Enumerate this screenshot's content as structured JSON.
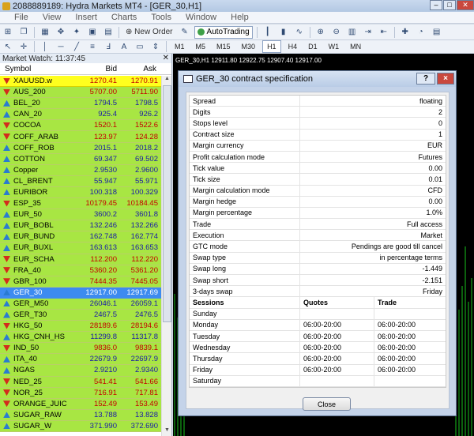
{
  "window": {
    "title": "2088889189: Hydra Markets MT4 - [GER_30,H1]"
  },
  "menu": [
    "File",
    "View",
    "Insert",
    "Charts",
    "Tools",
    "Window",
    "Help"
  ],
  "toolbar": {
    "new_order_label": "New Order",
    "autotrading_label": "AutoTrading"
  },
  "timeframes": [
    "M1",
    "M5",
    "M15",
    "M30",
    "H1",
    "H4",
    "D1",
    "W1",
    "MN"
  ],
  "active_timeframe": "H1",
  "market_watch": {
    "title": "Market Watch: 11:37:45",
    "columns": {
      "symbol": "Symbol",
      "bid": "Bid",
      "ask": "Ask"
    },
    "rows": [
      {
        "symbol": "XAUUSD.w",
        "bid": "1270.41",
        "ask": "1270.91",
        "dir": "down",
        "state": "highlight"
      },
      {
        "symbol": "AUS_200",
        "bid": "5707.00",
        "ask": "5711.90",
        "dir": "down"
      },
      {
        "symbol": "BEL_20",
        "bid": "1794.5",
        "ask": "1798.5",
        "dir": "up"
      },
      {
        "symbol": "CAN_20",
        "bid": "925.4",
        "ask": "926.2",
        "dir": "up"
      },
      {
        "symbol": "COCOA",
        "bid": "1520.1",
        "ask": "1522.6",
        "dir": "down"
      },
      {
        "symbol": "COFF_ARAB",
        "bid": "123.97",
        "ask": "124.28",
        "dir": "down"
      },
      {
        "symbol": "COFF_ROB",
        "bid": "2015.1",
        "ask": "2018.2",
        "dir": "up"
      },
      {
        "symbol": "COTTON",
        "bid": "69.347",
        "ask": "69.502",
        "dir": "up"
      },
      {
        "symbol": "Copper",
        "bid": "2.9530",
        "ask": "2.9600",
        "dir": "up"
      },
      {
        "symbol": "CL_BRENT",
        "bid": "55.947",
        "ask": "55.971",
        "dir": "up"
      },
      {
        "symbol": "EURIBOR",
        "bid": "100.318",
        "ask": "100.329",
        "dir": "up"
      },
      {
        "symbol": "ESP_35",
        "bid": "10179.45",
        "ask": "10184.45",
        "dir": "down"
      },
      {
        "symbol": "EUR_50",
        "bid": "3600.2",
        "ask": "3601.8",
        "dir": "up"
      },
      {
        "symbol": "EUR_BOBL",
        "bid": "132.246",
        "ask": "132.266",
        "dir": "up"
      },
      {
        "symbol": "EUR_BUND",
        "bid": "162.748",
        "ask": "162.774",
        "dir": "up"
      },
      {
        "symbol": "EUR_BUXL",
        "bid": "163.613",
        "ask": "163.653",
        "dir": "up"
      },
      {
        "symbol": "EUR_SCHA",
        "bid": "112.200",
        "ask": "112.220",
        "dir": "down"
      },
      {
        "symbol": "FRA_40",
        "bid": "5360.20",
        "ask": "5361.20",
        "dir": "down"
      },
      {
        "symbol": "GBR_100",
        "bid": "7444.35",
        "ask": "7445.05",
        "dir": "down"
      },
      {
        "symbol": "GER_30",
        "bid": "12917.00",
        "ask": "12917.69",
        "dir": "up",
        "state": "selected"
      },
      {
        "symbol": "GER_M50",
        "bid": "26046.1",
        "ask": "26059.1",
        "dir": "up"
      },
      {
        "symbol": "GER_T30",
        "bid": "2467.5",
        "ask": "2476.5",
        "dir": "up"
      },
      {
        "symbol": "HKG_50",
        "bid": "28189.6",
        "ask": "28194.6",
        "dir": "down"
      },
      {
        "symbol": "HKG_CNH_HS",
        "bid": "11299.8",
        "ask": "11317.8",
        "dir": "up"
      },
      {
        "symbol": "IND_50",
        "bid": "9836.0",
        "ask": "9839.1",
        "dir": "down"
      },
      {
        "symbol": "ITA_40",
        "bid": "22679.9",
        "ask": "22697.9",
        "dir": "up"
      },
      {
        "symbol": "NGAS",
        "bid": "2.9210",
        "ask": "2.9340",
        "dir": "up"
      },
      {
        "symbol": "NED_25",
        "bid": "541.41",
        "ask": "541.66",
        "dir": "down"
      },
      {
        "symbol": "NOR_25",
        "bid": "716.91",
        "ask": "717.81",
        "dir": "down"
      },
      {
        "symbol": "ORANGE_JUIC",
        "bid": "152.49",
        "ask": "153.49",
        "dir": "down"
      },
      {
        "symbol": "SUGAR_RAW",
        "bid": "13.788",
        "ask": "13.828",
        "dir": "up"
      },
      {
        "symbol": "SUGAR_W",
        "bid": "371.990",
        "ask": "372.690",
        "dir": "up"
      }
    ]
  },
  "chart": {
    "header": "GER_30,H1  12911.80 12922.75 12907.40 12917.00"
  },
  "dialog": {
    "title": "GER_30 contract specification",
    "help_button": "?",
    "close_x": "×",
    "spec": [
      {
        "key": "Spread",
        "value": "floating"
      },
      {
        "key": "Digits",
        "value": "2"
      },
      {
        "key": "Stops level",
        "value": "0"
      },
      {
        "key": "Contract size",
        "value": "1"
      },
      {
        "key": "Margin currency",
        "value": "EUR"
      },
      {
        "key": "Profit calculation mode",
        "value": "Futures"
      },
      {
        "key": "Tick value",
        "value": "0.00"
      },
      {
        "key": "Tick size",
        "value": "0.01"
      },
      {
        "key": "Margin calculation mode",
        "value": "CFD"
      },
      {
        "key": "Margin hedge",
        "value": "0.00"
      },
      {
        "key": "Margin percentage",
        "value": "1.0%"
      },
      {
        "key": "Trade",
        "value": "Full access"
      },
      {
        "key": "Execution",
        "value": "Market"
      },
      {
        "key": "GTC mode",
        "value": "Pendings are good till cancel"
      },
      {
        "key": "Swap type",
        "value": "in percentage terms"
      },
      {
        "key": "Swap long",
        "value": "-1.449"
      },
      {
        "key": "Swap short",
        "value": "-2.151"
      },
      {
        "key": "3-days swap",
        "value": "Friday"
      }
    ],
    "sessions_header": {
      "day": "Sessions",
      "quotes": "Quotes",
      "trade": "Trade"
    },
    "sessions": [
      {
        "day": "Sunday",
        "quotes": "",
        "trade": ""
      },
      {
        "day": "Monday",
        "quotes": "06:00-20:00",
        "trade": "06:00-20:00"
      },
      {
        "day": "Tuesday",
        "quotes": "06:00-20:00",
        "trade": "06:00-20:00"
      },
      {
        "day": "Wednesday",
        "quotes": "06:00-20:00",
        "trade": "06:00-20:00"
      },
      {
        "day": "Thursday",
        "quotes": "06:00-20:00",
        "trade": "06:00-20:00"
      },
      {
        "day": "Friday",
        "quotes": "06:00-20:00",
        "trade": "06:00-20:00"
      },
      {
        "day": "Saturday",
        "quotes": "",
        "trade": ""
      }
    ],
    "close_label": "Close"
  }
}
